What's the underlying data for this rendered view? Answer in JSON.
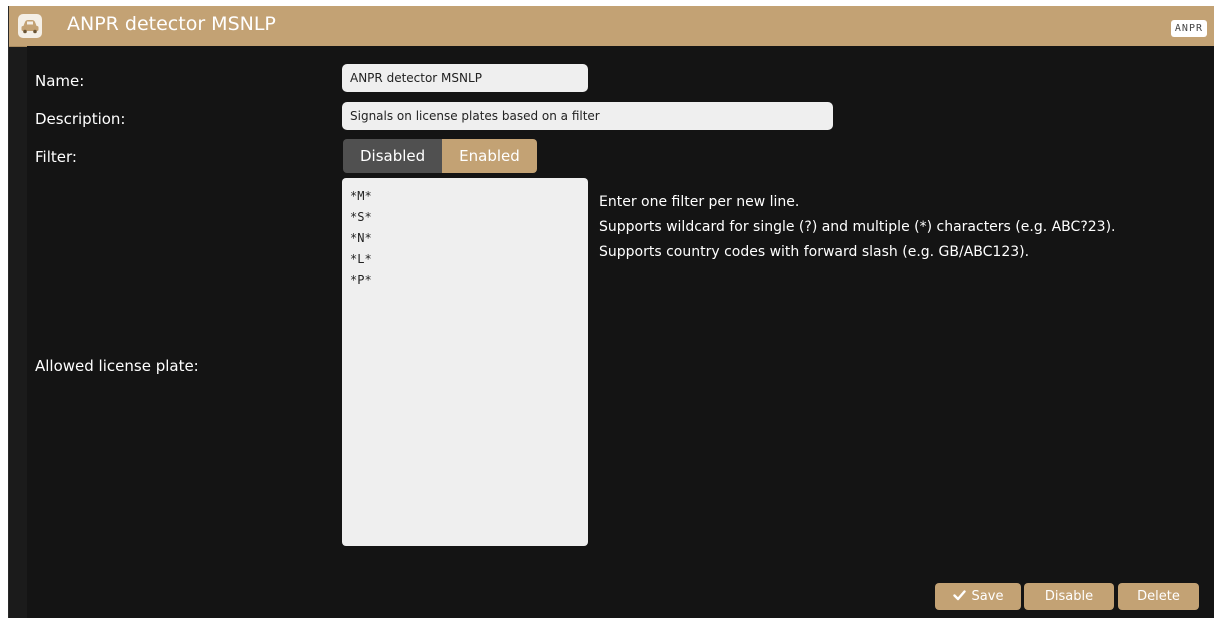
{
  "header": {
    "title": "ANPR detector MSNLP",
    "badge": "ANPR",
    "icon": "car-icon"
  },
  "form": {
    "name_label": "Name:",
    "name_value": "ANPR detector MSNLP",
    "description_label": "Description:",
    "description_value": "Signals on license plates based on a filter",
    "filter_label": "Filter:",
    "filter_options": [
      "Disabled",
      "Enabled"
    ],
    "filter_selected": "Enabled",
    "plates_label": "Allowed license plate:",
    "plates": [
      "*M*",
      "*S*",
      "*N*",
      "*L*",
      "*P*"
    ],
    "help_lines": [
      "Enter one filter per new line.",
      "Supports wildcard for single (?) and multiple (*) characters (e.g. ABC?23).",
      "Supports country codes with forward slash (e.g. GB/ABC123)."
    ]
  },
  "actions": {
    "save_label": "Save",
    "disable_label": "Disable",
    "delete_label": "Delete"
  },
  "colors": {
    "accent": "#c3a274",
    "panel": "#141414",
    "toggle_off": "#505050",
    "input_bg": "#efefef"
  }
}
